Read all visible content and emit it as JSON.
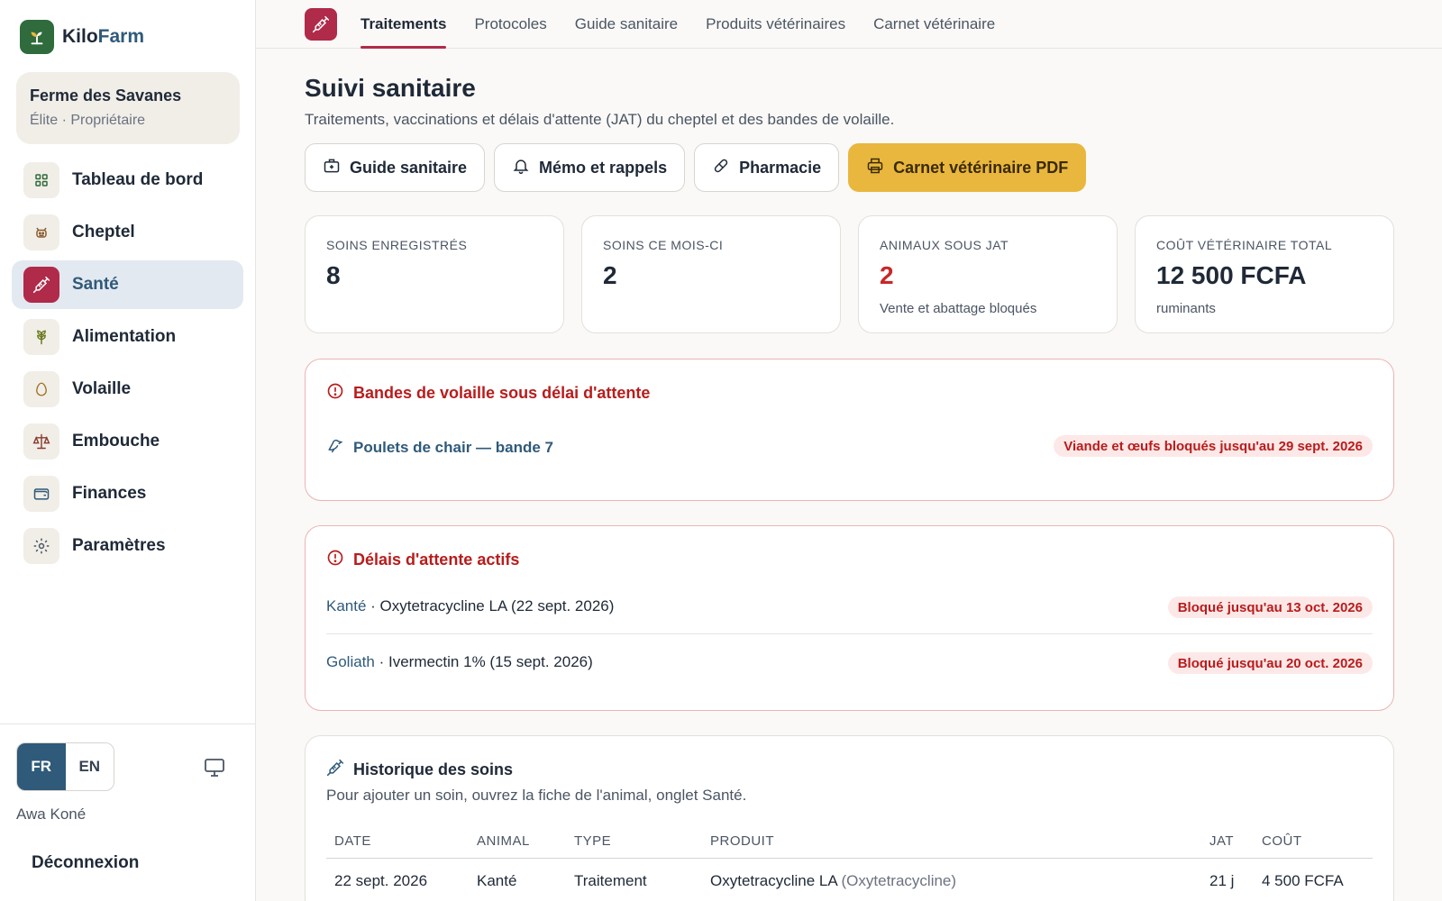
{
  "brand": {
    "name_part1": "Kilo",
    "name_part2": "Farm"
  },
  "farm": {
    "name": "Ferme des Savanes",
    "role": "Élite · Propriétaire"
  },
  "nav": {
    "items": [
      {
        "label": "Tableau de bord",
        "icon": "grid-icon"
      },
      {
        "label": "Cheptel",
        "icon": "cow-icon"
      },
      {
        "label": "Santé",
        "icon": "syringe-icon"
      },
      {
        "label": "Alimentation",
        "icon": "wheat-icon"
      },
      {
        "label": "Volaille",
        "icon": "egg-icon"
      },
      {
        "label": "Embouche",
        "icon": "scale-icon"
      },
      {
        "label": "Finances",
        "icon": "wallet-icon"
      },
      {
        "label": "Paramètres",
        "icon": "gear-icon"
      }
    ],
    "active_index": 2
  },
  "footer": {
    "lang_fr": "FR",
    "lang_en": "EN",
    "active_lang": "FR",
    "user_name": "Awa Koné",
    "logout_label": "Déconnexion"
  },
  "tabs": [
    {
      "label": "Traitements"
    },
    {
      "label": "Protocoles"
    },
    {
      "label": "Guide sanitaire"
    },
    {
      "label": "Produits vétérinaires"
    },
    {
      "label": "Carnet vétérinaire"
    }
  ],
  "header": {
    "title": "Suivi sanitaire",
    "subtitle": "Traitements, vaccinations et délais d'attente (JAT) du cheptel et des bandes de volaille."
  },
  "actions": {
    "guide": "Guide sanitaire",
    "memo": "Mémo et rappels",
    "pharmacy": "Pharmacie",
    "pdf": "Carnet vétérinaire PDF"
  },
  "stats": [
    {
      "label": "Soins enregistrés",
      "value": "8",
      "note": ""
    },
    {
      "label": "Soins ce mois-ci",
      "value": "2",
      "note": ""
    },
    {
      "label": "Animaux sous JAT",
      "value": "2",
      "note": "Vente et abattage bloqués"
    },
    {
      "label": "Coût vétérinaire total",
      "value": "12 500 FCFA",
      "note": "ruminants"
    }
  ],
  "poultry_alert": {
    "title": "Bandes de volaille sous délai d'attente",
    "batch_name": "Poulets de chair — bande 7",
    "badge": "Viande et œufs bloqués jusqu'au 29 sept. 2026"
  },
  "withdrawal_alert": {
    "title": "Délais d'attente actifs",
    "rows": [
      {
        "animal": "Kanté",
        "detail": " · Oxytetracycline LA (22 sept. 2026)",
        "badge": "Bloqué jusqu'au 13 oct. 2026"
      },
      {
        "animal": "Goliath",
        "detail": " · Ivermectin 1% (15 sept. 2026)",
        "badge": "Bloqué jusqu'au 20 oct. 2026"
      }
    ]
  },
  "history": {
    "title": "Historique des soins",
    "description": "Pour ajouter un soin, ouvrez la fiche de l'animal, onglet Santé.",
    "columns": {
      "date": "Date",
      "animal": "Animal",
      "type": "Type",
      "product": "Produit",
      "jat": "JAT",
      "cost": "Coût"
    },
    "rows": [
      {
        "date": "22 sept. 2026",
        "animal": "Kanté",
        "type": "Traitement",
        "product": "Oxytetracycline LA",
        "product_generic": "(Oxytetracycline)",
        "jat": "21 j",
        "cost": "4 500 FCFA"
      }
    ]
  },
  "colors": {
    "accent": "#b02a4a",
    "primary_blue": "#2f5a7a",
    "warning_yellow": "#e9b73e",
    "danger": "#b91c1c",
    "brand_green": "#2f6b3c"
  }
}
